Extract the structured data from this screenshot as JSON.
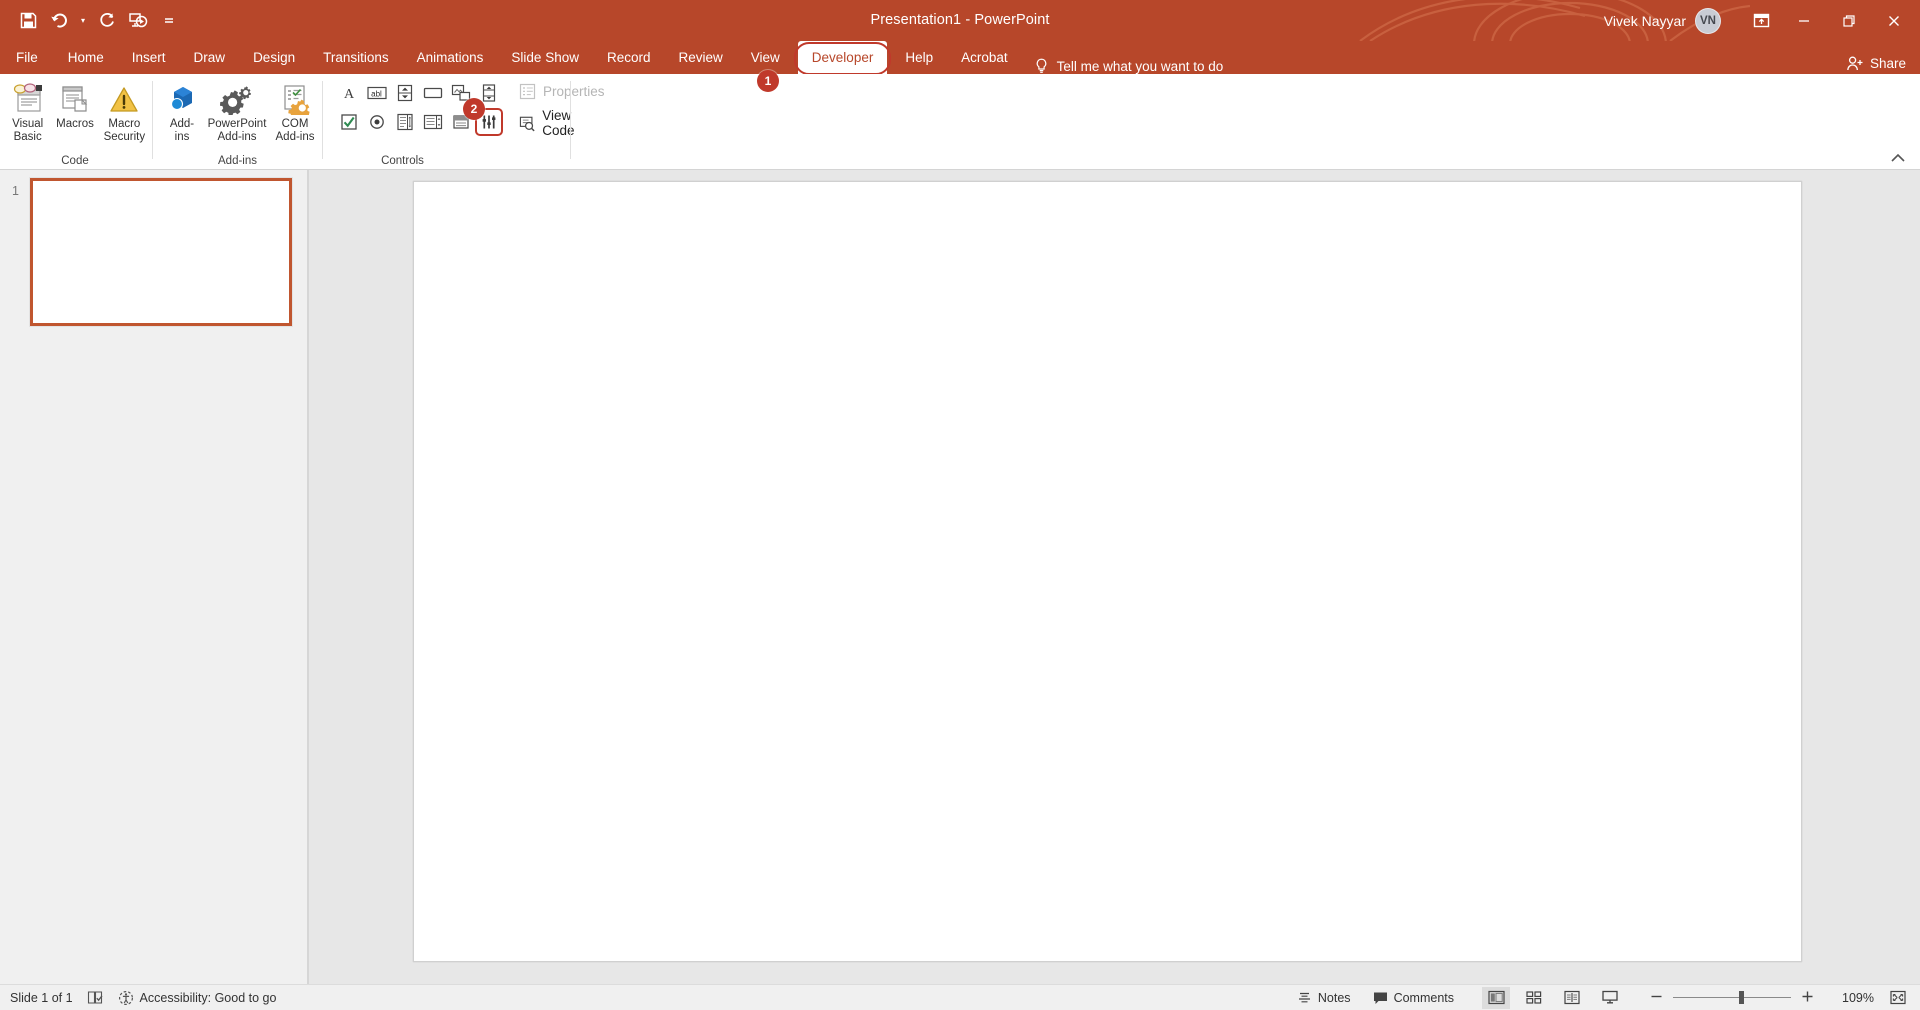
{
  "window": {
    "title": "Presentation1  -  PowerPoint",
    "user_name": "Vivek Nayyar",
    "avatar_initials": "VN",
    "accent_color": "#b7472a",
    "highlight_color": "#c0392b"
  },
  "quick_access": [
    {
      "name": "save-icon",
      "label": "Save"
    },
    {
      "name": "undo-icon",
      "label": "Undo"
    },
    {
      "name": "redo-icon",
      "label": "Redo"
    },
    {
      "name": "start-presentation-icon",
      "label": "Start From Beginning"
    },
    {
      "name": "customize-quick-access-icon",
      "label": "Customize Quick Access Toolbar"
    }
  ],
  "window_controls": [
    {
      "name": "ribbon-display-options-icon",
      "label": "Ribbon Display Options"
    },
    {
      "name": "minimize-icon",
      "label": "Minimize"
    },
    {
      "name": "restore-icon",
      "label": "Restore Down"
    },
    {
      "name": "close-icon",
      "label": "Close"
    }
  ],
  "tabs": [
    {
      "label": "File",
      "active": false
    },
    {
      "label": "Home",
      "active": false
    },
    {
      "label": "Insert",
      "active": false
    },
    {
      "label": "Draw",
      "active": false
    },
    {
      "label": "Design",
      "active": false
    },
    {
      "label": "Transitions",
      "active": false
    },
    {
      "label": "Animations",
      "active": false
    },
    {
      "label": "Slide Show",
      "active": false
    },
    {
      "label": "Record",
      "active": false
    },
    {
      "label": "Review",
      "active": false
    },
    {
      "label": "View",
      "active": false
    },
    {
      "label": "Developer",
      "active": true
    },
    {
      "label": "Help",
      "active": false
    },
    {
      "label": "Acrobat",
      "active": false
    }
  ],
  "tell_me": "Tell me what you want to do",
  "share_label": "Share",
  "badges": [
    {
      "number": "1",
      "target": "developer-tab"
    },
    {
      "number": "2",
      "target": "more-controls-button"
    }
  ],
  "ribbon": {
    "groups": [
      {
        "name": "code",
        "label": "Code",
        "buttons": [
          {
            "name": "visual-basic-button",
            "label": "Visual\nBasic"
          },
          {
            "name": "macros-button",
            "label": "Macros"
          },
          {
            "name": "macro-security-button",
            "label": "Macro\nSecurity"
          }
        ]
      },
      {
        "name": "add-ins",
        "label": "Add-ins",
        "buttons": [
          {
            "name": "add-ins-button",
            "label": "Add-\nins"
          },
          {
            "name": "powerpoint-add-ins-button",
            "label": "PowerPoint\nAdd-ins"
          },
          {
            "name": "com-add-ins-button",
            "label": "COM\nAdd-ins"
          }
        ]
      },
      {
        "name": "controls",
        "label": "Controls",
        "row1": [
          {
            "name": "label-control-button",
            "label": "Label"
          },
          {
            "name": "text-box-control-button",
            "label": "Text Box"
          },
          {
            "name": "spin-button-control-button",
            "label": "Spin Button"
          },
          {
            "name": "command-button-control-button",
            "label": "Command Button"
          },
          {
            "name": "image-control-button",
            "label": "Image"
          },
          {
            "name": "scroll-bar-control-button",
            "label": "Scroll Bar"
          }
        ],
        "row2": [
          {
            "name": "check-box-control-button",
            "label": "Check Box"
          },
          {
            "name": "option-button-control-button",
            "label": "Option Button"
          },
          {
            "name": "list-box-control-button",
            "label": "List Box"
          },
          {
            "name": "combo-box-control-button",
            "label": "Combo Box"
          },
          {
            "name": "toggle-button-control-button",
            "label": "Toggle Button"
          },
          {
            "name": "more-controls-button",
            "label": "More Controls",
            "highlighted": true
          }
        ],
        "side_items": [
          {
            "name": "properties-button",
            "label": "Properties",
            "disabled": true
          },
          {
            "name": "view-code-button",
            "label": "View Code",
            "disabled": false
          }
        ]
      }
    ],
    "collapse_label": "Collapse the Ribbon"
  },
  "slides": {
    "items": [
      {
        "number": "1",
        "selected": true
      }
    ]
  },
  "status_bar": {
    "slide_counter": "Slide 1 of 1",
    "language_icon": "spell-check-icon",
    "accessibility": "Accessibility: Good to go",
    "notes_label": "Notes",
    "comments_label": "Comments",
    "views": [
      {
        "name": "normal-view-button",
        "label": "Normal",
        "active": true
      },
      {
        "name": "slide-sorter-view-button",
        "label": "Slide Sorter",
        "active": false
      },
      {
        "name": "reading-view-button",
        "label": "Reading View",
        "active": false
      },
      {
        "name": "slide-show-button",
        "label": "Slide Show",
        "active": false
      }
    ],
    "zoom_out_label": "Zoom Out",
    "zoom_in_label": "Zoom In",
    "zoom_level": "109%",
    "fit_label": "Fit slide to current window"
  }
}
